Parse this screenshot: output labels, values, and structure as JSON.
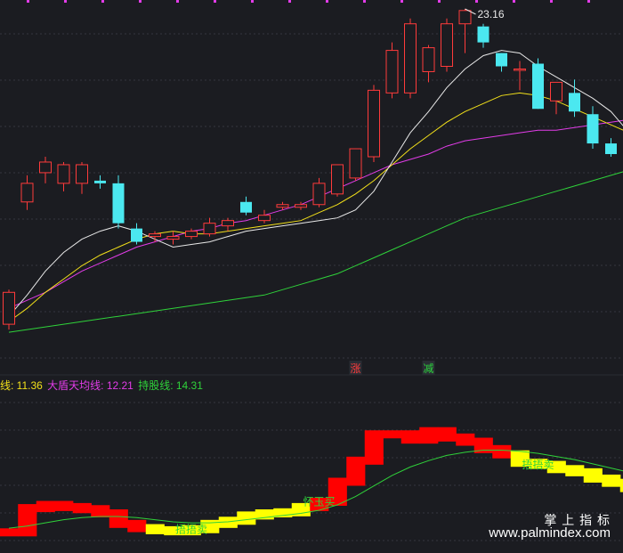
{
  "chart_data": [
    {
      "type": "candlestick",
      "peak_label": "23.16",
      "markers": [
        {
          "index": 19,
          "label": "涨",
          "color": "#ff3b3b"
        },
        {
          "index": 23,
          "label": "减",
          "color": "#2bd43b"
        }
      ],
      "candles": [
        {
          "o": 11.3,
          "h": 12.6,
          "l": 11.1,
          "c": 12.5
        },
        {
          "o": 15.9,
          "h": 16.9,
          "l": 15.6,
          "c": 16.6
        },
        {
          "o": 17.0,
          "h": 17.6,
          "l": 16.6,
          "c": 17.4
        },
        {
          "o": 16.6,
          "h": 17.4,
          "l": 16.3,
          "c": 17.3
        },
        {
          "o": 16.6,
          "h": 17.4,
          "l": 16.2,
          "c": 17.3
        },
        {
          "o": 16.7,
          "h": 16.9,
          "l": 16.4,
          "c": 16.6
        },
        {
          "o": 16.6,
          "h": 16.9,
          "l": 14.9,
          "c": 15.1
        },
        {
          "o": 14.9,
          "h": 15.1,
          "l": 14.3,
          "c": 14.4
        },
        {
          "o": 14.6,
          "h": 14.8,
          "l": 14.4,
          "c": 14.7
        },
        {
          "o": 14.5,
          "h": 14.8,
          "l": 14.3,
          "c": 14.6
        },
        {
          "o": 14.6,
          "h": 14.9,
          "l": 14.5,
          "c": 14.8
        },
        {
          "o": 14.7,
          "h": 15.3,
          "l": 14.6,
          "c": 15.1
        },
        {
          "o": 15.0,
          "h": 15.3,
          "l": 14.8,
          "c": 15.2
        },
        {
          "o": 15.9,
          "h": 16.1,
          "l": 15.4,
          "c": 15.5
        },
        {
          "o": 15.2,
          "h": 15.6,
          "l": 15.1,
          "c": 15.4
        },
        {
          "o": 15.7,
          "h": 15.9,
          "l": 15.6,
          "c": 15.8
        },
        {
          "o": 15.7,
          "h": 15.9,
          "l": 15.6,
          "c": 15.8
        },
        {
          "o": 15.8,
          "h": 16.8,
          "l": 15.7,
          "c": 16.6
        },
        {
          "o": 16.2,
          "h": 17.1,
          "l": 16.1,
          "c": 17.3
        },
        {
          "o": 16.8,
          "h": 17.7,
          "l": 16.7,
          "c": 17.9
        },
        {
          "o": 17.6,
          "h": 20.3,
          "l": 17.4,
          "c": 20.1
        },
        {
          "o": 20.0,
          "h": 21.9,
          "l": 19.8,
          "c": 21.6
        },
        {
          "o": 20.0,
          "h": 22.8,
          "l": 19.8,
          "c": 22.6
        },
        {
          "o": 20.8,
          "h": 21.8,
          "l": 20.4,
          "c": 21.7
        },
        {
          "o": 21.0,
          "h": 22.8,
          "l": 20.8,
          "c": 22.6
        },
        {
          "o": 22.6,
          "h": 23.16,
          "l": 21.5,
          "c": 23.1
        },
        {
          "o": 22.5,
          "h": 22.6,
          "l": 21.7,
          "c": 21.9
        },
        {
          "o": 21.5,
          "h": 21.5,
          "l": 20.8,
          "c": 21.0
        },
        {
          "o": 20.9,
          "h": 21.2,
          "l": 20.1,
          "c": 20.9
        },
        {
          "o": 21.1,
          "h": 21.3,
          "l": 19.4,
          "c": 19.4
        },
        {
          "o": 19.7,
          "h": 20.4,
          "l": 19.2,
          "c": 20.4
        },
        {
          "o": 20.0,
          "h": 20.5,
          "l": 19.1,
          "c": 19.3
        },
        {
          "o": 19.2,
          "h": 19.5,
          "l": 17.9,
          "c": 18.1
        },
        {
          "o": 18.1,
          "h": 18.3,
          "l": 17.6,
          "c": 17.7
        },
        {
          "o": 17.6,
          "h": 17.9,
          "l": 17.3,
          "c": 17.7
        },
        {
          "o": 17.5,
          "h": 17.9,
          "l": 16.6,
          "c": 16.9
        }
      ],
      "ma_white": [
        11.6,
        12.4,
        13.3,
        14.0,
        14.5,
        14.8,
        15.0,
        14.8,
        14.5,
        14.2,
        14.3,
        14.4,
        14.6,
        14.8,
        14.9,
        15.0,
        15.1,
        15.2,
        15.3,
        15.6,
        16.3,
        17.4,
        18.5,
        19.3,
        20.2,
        20.9,
        21.4,
        21.6,
        21.5,
        21.0,
        20.6,
        20.2,
        19.8,
        19.3,
        18.5
      ],
      "ma_yellow": [
        11.4,
        11.9,
        12.5,
        13.0,
        13.5,
        13.9,
        14.2,
        14.5,
        14.7,
        14.8,
        14.7,
        14.7,
        14.8,
        14.9,
        15.0,
        15.1,
        15.2,
        15.5,
        15.8,
        16.2,
        16.7,
        17.3,
        17.9,
        18.4,
        18.9,
        19.3,
        19.6,
        19.9,
        20.0,
        19.9,
        19.7,
        19.4,
        19.1,
        18.8,
        18.5
      ],
      "ma_magenta": [
        11.9,
        12.2,
        12.5,
        12.9,
        13.3,
        13.6,
        13.9,
        14.2,
        14.4,
        14.6,
        14.8,
        14.9,
        15.1,
        15.2,
        15.4,
        15.6,
        15.8,
        16.1,
        16.4,
        16.7,
        17.0,
        17.3,
        17.5,
        17.7,
        18.0,
        18.2,
        18.3,
        18.4,
        18.5,
        18.6,
        18.6,
        18.7,
        18.8,
        18.9,
        19.0
      ],
      "ma_green": [
        11.0,
        11.1,
        11.2,
        11.3,
        11.4,
        11.5,
        11.6,
        11.7,
        11.8,
        11.9,
        12.0,
        12.1,
        12.2,
        12.3,
        12.4,
        12.6,
        12.8,
        13.0,
        13.2,
        13.5,
        13.8,
        14.1,
        14.4,
        14.7,
        15.0,
        15.3,
        15.5,
        15.7,
        15.9,
        16.1,
        16.3,
        16.5,
        16.7,
        16.9,
        17.1
      ]
    },
    {
      "type": "bar",
      "levels": [
        1.2,
        3.5,
        3.8,
        3.6,
        3.4,
        3.0,
        2.0,
        1.6,
        1.4,
        1.3,
        1.5,
        2.0,
        2.3,
        2.8,
        3.0,
        3.1,
        3.6,
        4.1,
        6.0,
        8.0,
        10.5,
        10.5,
        10.0,
        10.8,
        10.2,
        9.8,
        9.1,
        8.6,
        7.8,
        7.6,
        7.2,
        6.9,
        6.3,
        5.9,
        5.4
      ],
      "colors": [
        "red",
        "red",
        "red",
        "red",
        "red",
        "red",
        "red",
        "red",
        "yellow",
        "yellow",
        "yellow",
        "yellow",
        "yellow",
        "yellow",
        "yellow",
        "yellow",
        "yellow",
        "red",
        "red",
        "red",
        "red",
        "red",
        "red",
        "red",
        "red",
        "red",
        "red",
        "red",
        "yellow",
        "yellow",
        "yellow",
        "yellow",
        "yellow",
        "yellow",
        "yellow"
      ],
      "ma": [
        1.6,
        1.8,
        2.1,
        2.4,
        2.6,
        2.7,
        2.7,
        2.6,
        2.4,
        2.2,
        2.1,
        2.1,
        2.2,
        2.4,
        2.6,
        2.8,
        3.0,
        3.3,
        3.8,
        4.6,
        5.6,
        6.6,
        7.4,
        8.0,
        8.5,
        8.8,
        9.0,
        9.0,
        8.9,
        8.7,
        8.4,
        8.1,
        7.7,
        7.3,
        6.9
      ],
      "annotations": [
        {
          "index": 10,
          "label": "捂捂卖"
        },
        {
          "index": 17,
          "label": "怀玉买"
        },
        {
          "index": 29,
          "label": "捂捂卖"
        }
      ]
    }
  ],
  "legend": {
    "line1": "线: 11.36",
    "line2": "大盾天均线: 12.21",
    "line3": "持股线: 14.31"
  },
  "watermark": {
    "title": "掌 上 指 标",
    "url": "www.palmindex.com"
  },
  "colors": {
    "bg": "#1b1c21",
    "up": "#ff3b3b",
    "down": "#4be8f0",
    "white": "#e8e8e8",
    "yellow": "#f2e01a",
    "magenta": "#e23ce8",
    "green": "#2fd23a"
  }
}
